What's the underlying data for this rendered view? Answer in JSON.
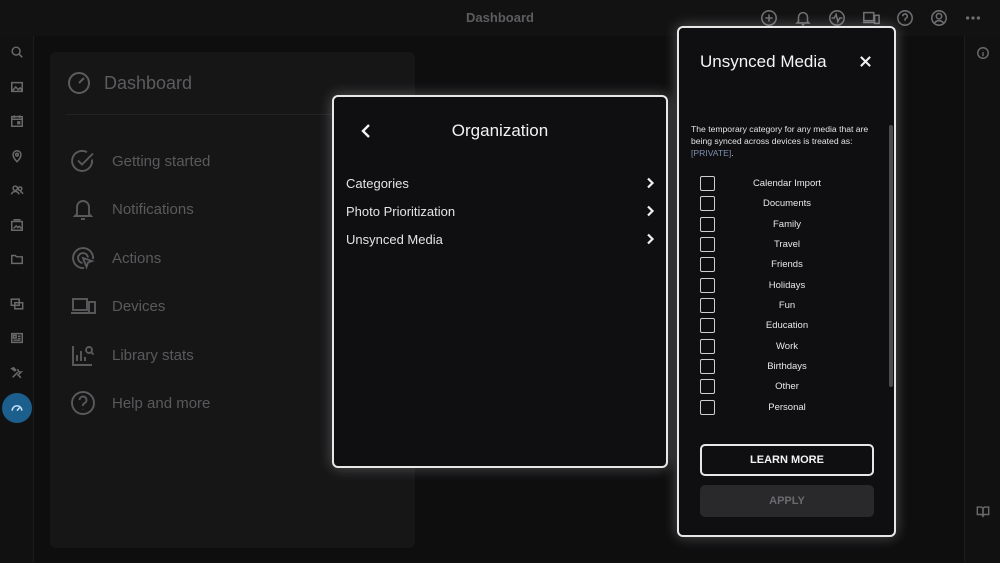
{
  "window": {
    "title": "Dashboard"
  },
  "topbar_icons": [
    "add-icon",
    "bell-icon",
    "activity-icon",
    "devices-icon",
    "help-icon",
    "account-icon",
    "more-icon"
  ],
  "left_rail": {
    "items": [
      "search-icon",
      "photos-icon",
      "calendar-icon",
      "places-icon",
      "people-icon",
      "albums-icon",
      "folders-icon",
      "collections-icon",
      "library-icon",
      "tools-icon",
      "dashboard-icon"
    ],
    "active": "dashboard-icon",
    "accent": "#1c5e8c"
  },
  "dashboard": {
    "title": "Dashboard",
    "items": [
      {
        "label": "Getting started",
        "icon": "check-circle-icon"
      },
      {
        "label": "Notifications",
        "icon": "bell-icon"
      },
      {
        "label": "Actions",
        "icon": "target-cursor-icon"
      },
      {
        "label": "Devices",
        "icon": "devices-icon"
      },
      {
        "label": "Library stats",
        "icon": "stats-icon"
      },
      {
        "label": "Help and more",
        "icon": "help-icon"
      }
    ]
  },
  "organization": {
    "title": "Organization",
    "rows": [
      {
        "label": "Categories"
      },
      {
        "label": "Photo Prioritization"
      },
      {
        "label": "Unsynced Media"
      }
    ]
  },
  "unsynced": {
    "title": "Unsynced Media",
    "description": "The temporary category for any media that are being synced across devices is treated as:",
    "private_tag": "[PRIVATE]",
    "description_end": ".",
    "categories": [
      {
        "label": "Calendar Import",
        "checked": false
      },
      {
        "label": "Documents",
        "checked": false
      },
      {
        "label": "Family",
        "checked": false
      },
      {
        "label": "Travel",
        "checked": false
      },
      {
        "label": "Friends",
        "checked": false
      },
      {
        "label": "Holidays",
        "checked": false
      },
      {
        "label": "Fun",
        "checked": false
      },
      {
        "label": "Education",
        "checked": false
      },
      {
        "label": "Work",
        "checked": false
      },
      {
        "label": "Birthdays",
        "checked": false
      },
      {
        "label": "Other",
        "checked": false
      },
      {
        "label": "Personal",
        "checked": false
      }
    ],
    "learn_more": "LEARN MORE",
    "apply": "APPLY"
  }
}
